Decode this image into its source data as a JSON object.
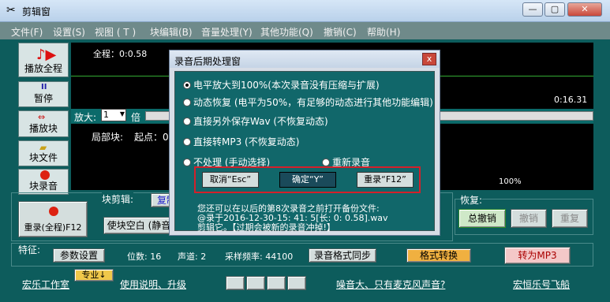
{
  "window": {
    "title": "剪辑窗",
    "min": "0",
    "max": "1",
    "close": "r"
  },
  "menu": [
    "文件(F)",
    "设置(S)",
    "视图 ( T )",
    "块编辑(B)",
    "音量处理(Y)",
    "其他功能(Q)",
    "撤销(C)",
    "帮助(H)"
  ],
  "left_buttons": [
    "播放全程",
    "暂停",
    "播放块",
    "块文件",
    "块录音"
  ],
  "wave": {
    "total_label": "全程：0:0.58",
    "time_end": "0:16.31",
    "zoom_label": "放大:",
    "zoom_value": "1",
    "zoom_unit": "倍",
    "block_label": "局部块:",
    "start_label": "起点：0:",
    "percent": "100%"
  },
  "block_edit": {
    "label": "块剪辑:",
    "copy": "复制",
    "rerecord": "重录(全程)F12",
    "blank": "使块空白 (静音"
  },
  "restore": {
    "label": "恢复:",
    "undo_all": "总撤销",
    "undo": "撤销",
    "redo": "重复"
  },
  "features": {
    "label": "特征:",
    "params": "参数设置",
    "bits": "位数: 16",
    "channels": "声道: 2",
    "rate": "采样频率: 44100",
    "sync": "录音格式同步",
    "convert": "格式转换",
    "tomp3": "转为MP3"
  },
  "bottom": {
    "studio": "宏乐工作室",
    "pro": "专业↓",
    "help": "使用说明、升级",
    "noise": "噪音大、只有麦克风声音?",
    "brand": "宏恒乐号飞船"
  },
  "dialog": {
    "title": "录音后期处理窗",
    "close": "x",
    "options": [
      {
        "text": "电平放大到100%(本次录音没有压缩与扩展)",
        "checked": true
      },
      {
        "text": "动态恢复 (电平为50%，有足够的动态进行其他功能编辑)",
        "checked": false
      },
      {
        "text": "直接另外保存Wav (不恢复动态)",
        "checked": false
      },
      {
        "text": "直接转MP3 (不恢复动态)",
        "checked": false
      },
      {
        "text": "不处理 (手动选择)",
        "checked": false
      }
    ],
    "rerecord_option": "重新录音",
    "cancel_btn": "取消“Esc”",
    "ok_btn": "确定“Y”",
    "redo_btn": "重录“F12”",
    "note1": "您还可以在以后的第8次录音之前打开备份文件:",
    "note2": "@录于2016-12-30-15: 41: 5[长: 0: 0.58].wav",
    "note3": "剪辑它。【过期会被新的录音冲掉!】"
  }
}
